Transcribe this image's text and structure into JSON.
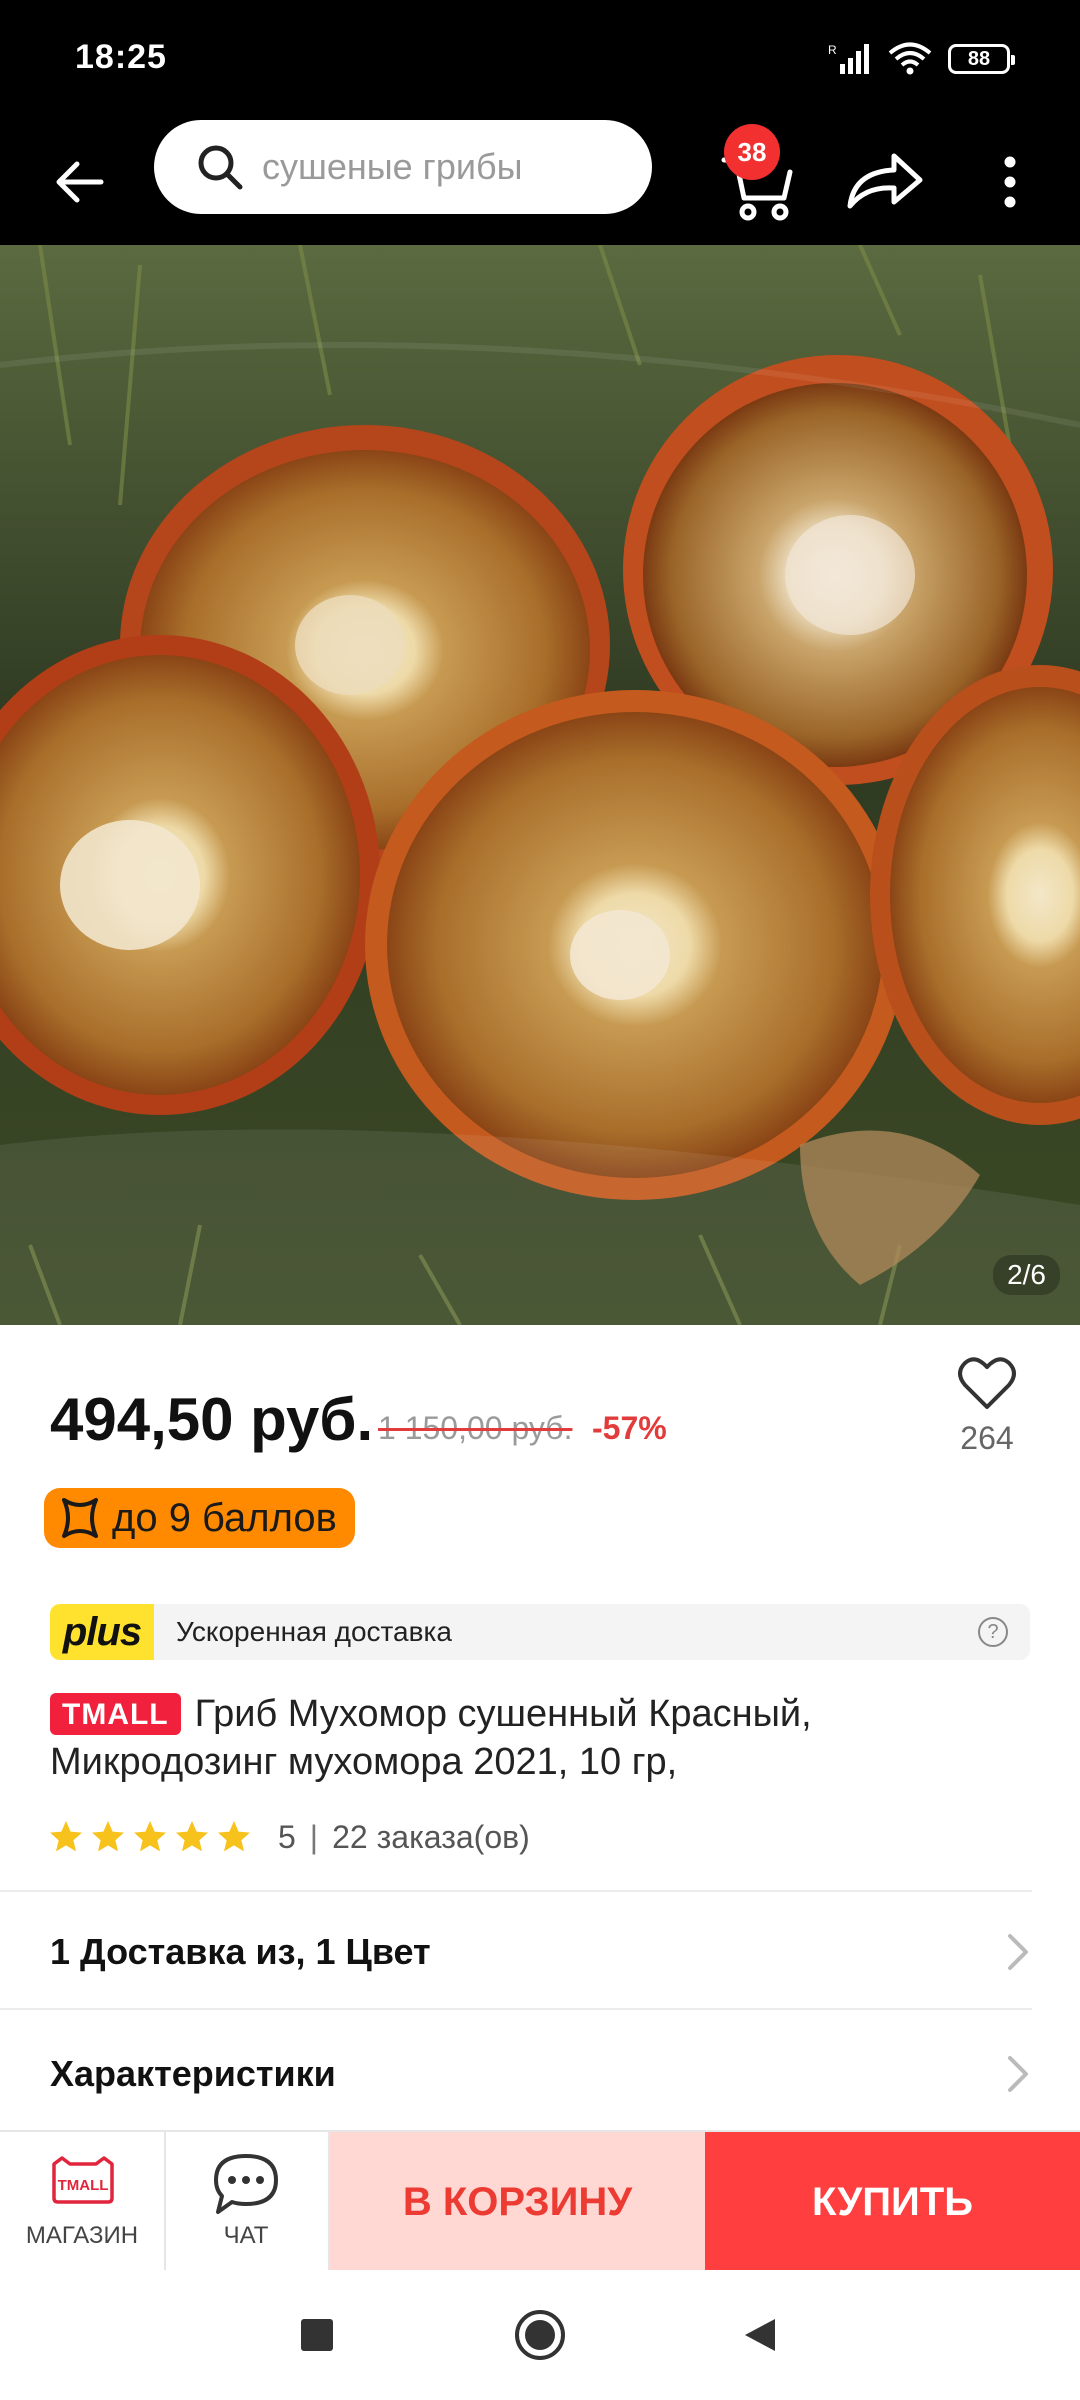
{
  "status_bar": {
    "time": "18:25",
    "battery": "88"
  },
  "header": {
    "search_placeholder": "сушеные грибы",
    "cart_count": "38"
  },
  "gallery": {
    "counter": "2/6"
  },
  "pricing": {
    "price": "494,50 руб.",
    "old_price": "1 150,00 руб.",
    "discount": "-57%",
    "favorites_count": "264",
    "points_label": "до 9 баллов"
  },
  "delivery_plus": {
    "logo_text": "plus",
    "label": "Ускоренная доставка"
  },
  "product": {
    "badge": "TMALL",
    "title": "Гриб Мухомор сушенный Красный, Микродозинг мухомора  2021, 10 гр,",
    "rating_value": "5",
    "rating_separator": "|",
    "orders": "22 заказа(ов)",
    "stars": 5
  },
  "rows": {
    "delivery_options": "1 Доставка из, 1 Цвет",
    "characteristics": "Характеристики"
  },
  "actions": {
    "store_label": "МАГАЗИН",
    "store_icon_text": "TMALL",
    "chat_label": "ЧАТ",
    "add_to_cart_label": "В КОРЗИНУ",
    "buy_label": "КУПИТЬ"
  },
  "colors": {
    "accent_red": "#ff3f3f",
    "cart_btn_bg": "#ffd7d3",
    "points_orange": "#ff8a00",
    "plus_yellow": "#ffe22e",
    "star_yellow": "#f7c21b"
  }
}
